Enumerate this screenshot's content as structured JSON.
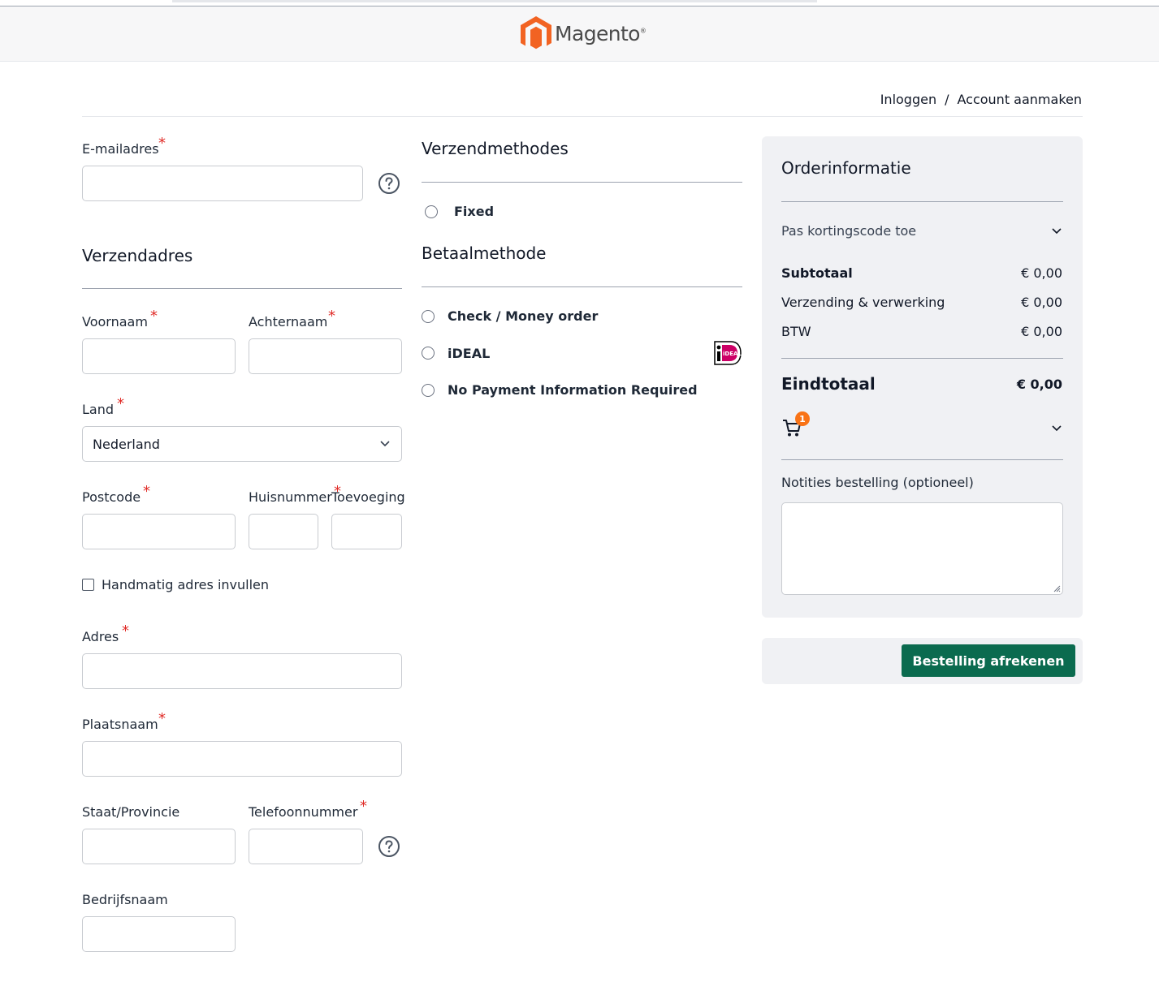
{
  "header": {
    "logo_text": "Magento",
    "logo_reg": "®"
  },
  "toplinks": {
    "login": "Inloggen",
    "separator": "/",
    "create_account": "Account aanmaken"
  },
  "form": {
    "email_label": "E-mailadres",
    "shipping_address_heading": "Verzendadres",
    "firstname_label": "Voornaam",
    "lastname_label": "Achternaam",
    "country_label": "Land",
    "country_value": "Nederland",
    "postcode_label": "Postcode",
    "housenumber_label": "Huisnummer",
    "addition_label": "Toevoeging",
    "manual_address_label": "Handmatig adres invullen",
    "address_label": "Adres",
    "city_label": "Plaatsnaam",
    "region_label": "Staat/Provincie",
    "phone_label": "Telefoonnummer",
    "company_label": "Bedrijfsnaam",
    "required_marker": "*"
  },
  "shipping": {
    "heading": "Verzendmethodes",
    "methods": [
      "Fixed"
    ]
  },
  "payment": {
    "heading": "Betaalmethode",
    "methods": [
      "Check / Money order",
      "iDEAL",
      "No Payment Information Required"
    ],
    "ideal_logo_text": "iDEAL"
  },
  "summary": {
    "heading": "Orderinformatie",
    "coupon_label": "Pas kortingscode toe",
    "subtotal_label": "Subtotaal",
    "subtotal_value": "€ 0,00",
    "shipping_label": "Verzending & verwerking",
    "shipping_value": "€ 0,00",
    "tax_label": "BTW",
    "tax_value": "€ 0,00",
    "grand_total_label": "Eindtotaal",
    "grand_total_value": "€ 0,00",
    "cart_count": "1",
    "notes_label": "Notities bestelling (optioneel)",
    "place_order_label": "Bestelling afrekenen"
  },
  "colors": {
    "accent_button": "#0b6b4f",
    "required": "#e02b27",
    "badge": "#f97316",
    "logo": "#f26322"
  }
}
